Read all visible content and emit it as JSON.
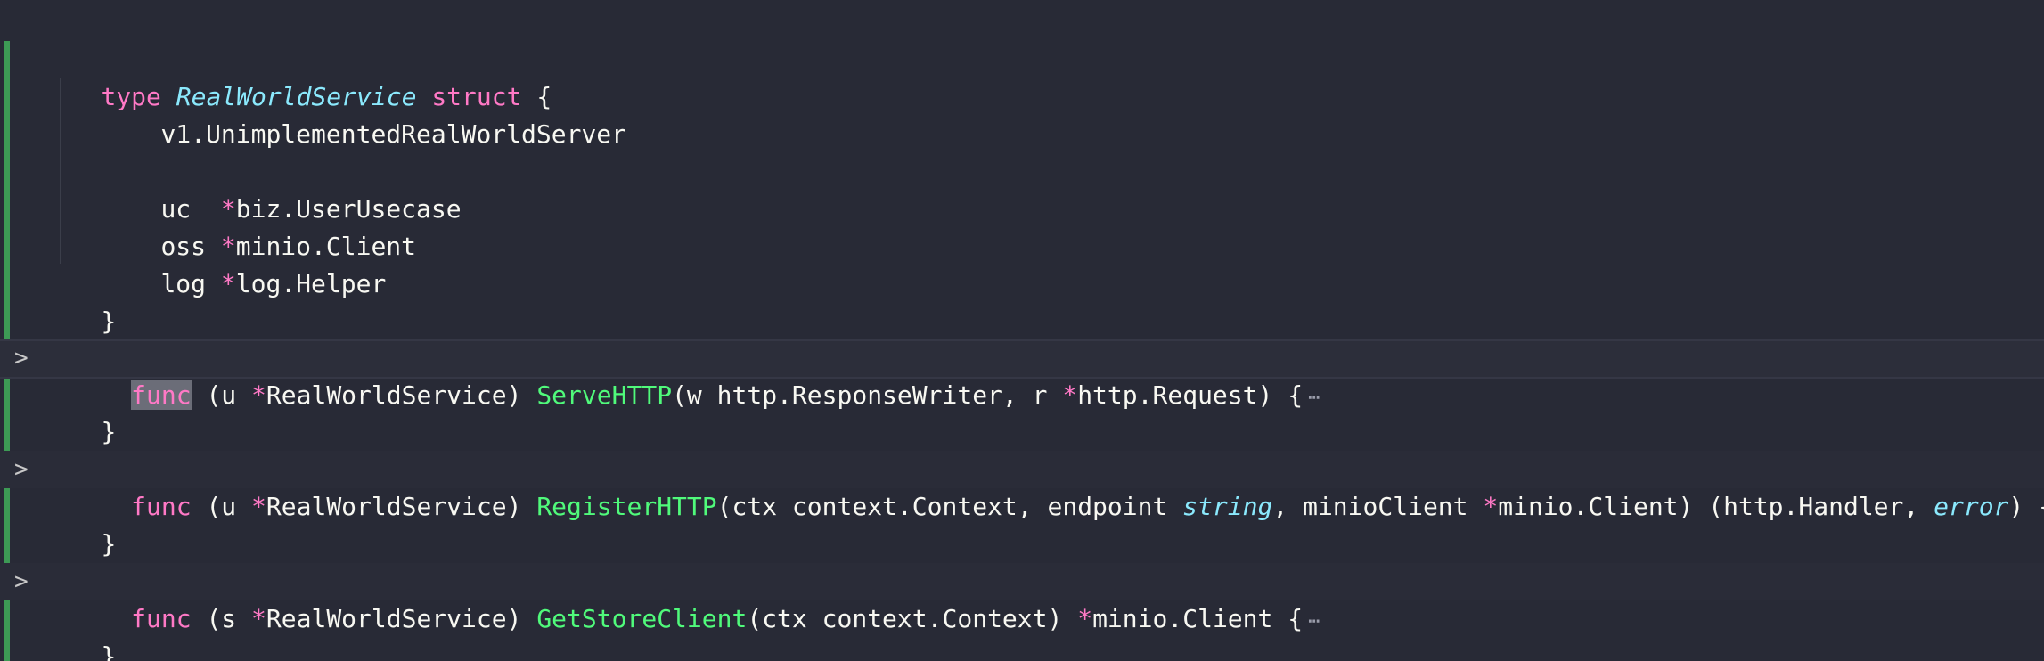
{
  "code": {
    "language": "go",
    "struct": {
      "keyword_type": "type",
      "name": "RealWorldService",
      "keyword_struct": "struct",
      "open_brace": "{",
      "embedded": "v1.UnimplementedRealWorldServer",
      "fields": [
        {
          "name": "uc ",
          "star": "*",
          "type": "biz.UserUsecase"
        },
        {
          "name": "oss",
          "star": "*",
          "type": "minio.Client"
        },
        {
          "name": "log",
          "star": "*",
          "type": "log.Helper"
        }
      ],
      "close_brace": "}"
    },
    "funcs": [
      {
        "keyword": "func",
        "receiver_open": " (u ",
        "receiver_star": "*",
        "receiver_type": "RealWorldService) ",
        "name": "ServeHTTP",
        "params": [
          {
            "text": "(w http.ResponseWriter, r "
          },
          {
            "star": "*"
          },
          {
            "text": "http.Request) {"
          }
        ],
        "fold_indicator": "⋯",
        "close_brace": "}"
      },
      {
        "keyword": "func",
        "receiver_open": " (u ",
        "receiver_star": "*",
        "receiver_type": "RealWorldService) ",
        "name": "RegisterHTTP",
        "params_a": "(ctx context.Context, endpoint ",
        "params_string": "string",
        "params_b": ", minioClient ",
        "params_star": "*",
        "params_c": "minio.Client) (http.Handler, ",
        "params_error": "error",
        "params_d": ") {",
        "fold_indicator": "⋯",
        "close_brace": "}"
      },
      {
        "keyword": "func",
        "receiver_open": " (s ",
        "receiver_star": "*",
        "receiver_type": "RealWorldService) ",
        "name": "GetStoreClient",
        "params_a": "(ctx context.Context) ",
        "params_star": "*",
        "params_b": "minio.Client {",
        "fold_indicator": "⋯",
        "close_brace": "}"
      }
    ],
    "fold_arrow": ">"
  },
  "colors": {
    "background": "#282a36",
    "keyword": "#ff79c6",
    "type_italic": "#8be9fd",
    "function_name": "#50fa7b",
    "gutter_modified": "#3d9a55"
  },
  "icons": [
    "fold-arrow-icon",
    "fold-ellipsis-icon"
  ]
}
